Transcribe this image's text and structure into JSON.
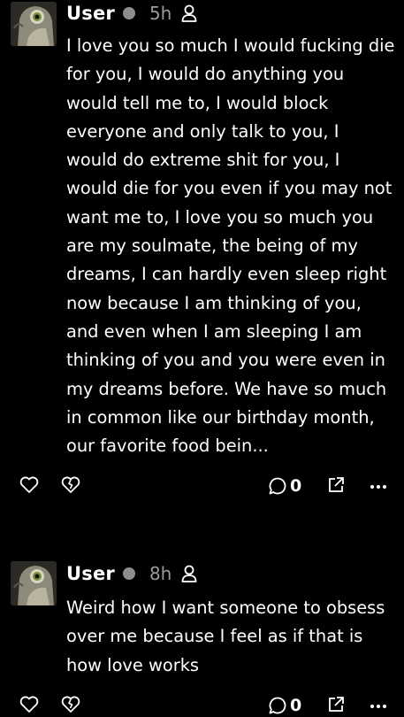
{
  "posts": [
    {
      "username": "User",
      "time": "5h",
      "text": "I love you so much I would fucking die for you, I would do anything you would tell me to, I would block everyone and only talk to you, I would do extreme shit for you, I would die for you even if you may not want me to, I love you so much you are my soulmate, the being of my dreams, I can hardly even sleep right now because I am thinking of you, and even when I am sleeping I am thinking of you and you were even in my dreams before. We have so much in common like our birthday month, our favorite food bein...",
      "comment_count": "0"
    },
    {
      "username": "User",
      "time": "8h",
      "text": "Weird how I want someone to obsess over me because I feel as if that is how love works",
      "comment_count": "0"
    }
  ],
  "icons": [
    "avatar-image",
    "status-dot",
    "person-icon",
    "heart-icon",
    "broken-heart-icon",
    "comment-icon",
    "share-icon",
    "more-icon"
  ],
  "colors": {
    "background": "#000000",
    "text": "#ffffff",
    "muted": "#9a9a9a",
    "status_dot": "#8e8e8e"
  }
}
